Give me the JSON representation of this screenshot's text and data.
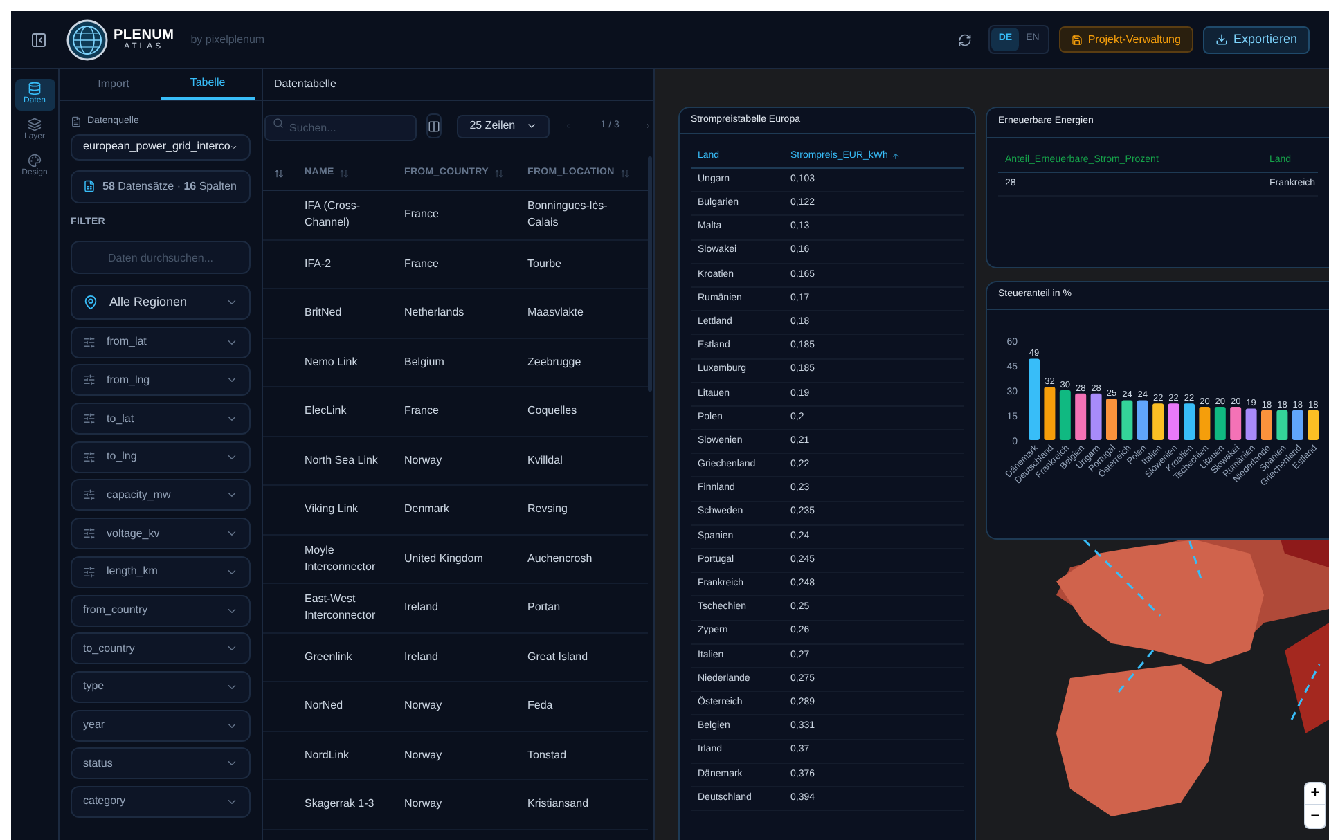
{
  "header": {
    "logo_title": "PLENUM",
    "logo_subtitle": "ATLAS",
    "byline": "by pixelplenum",
    "languages": [
      {
        "label": "DE",
        "selected": true
      },
      {
        "label": "EN",
        "selected": false
      }
    ],
    "project_button": "Projekt-Verwaltung",
    "export_button": "Exportieren"
  },
  "rail": [
    {
      "label": "Daten",
      "selected": true
    },
    {
      "label": "Layer",
      "selected": false
    },
    {
      "label": "Design",
      "selected": false
    }
  ],
  "sidebar": {
    "tabs": [
      {
        "label": "Import",
        "selected": false
      },
      {
        "label": "Tabelle",
        "selected": true
      }
    ],
    "source_label": "Datenquelle",
    "source_value": "european_power_grid_interco",
    "records": "**58** Datensätze · **16** Spalten",
    "filter_heading": "FILTER",
    "search_placeholder": "Daten durchsuchen...",
    "filters": [
      {
        "kind": "region",
        "label": "Alle Regionen"
      },
      {
        "kind": "numeric",
        "label": "from_lat"
      },
      {
        "kind": "numeric",
        "label": "from_lng"
      },
      {
        "kind": "numeric",
        "label": "to_lat"
      },
      {
        "kind": "numeric",
        "label": "to_lng"
      },
      {
        "kind": "numeric",
        "label": "capacity_mw"
      },
      {
        "kind": "numeric",
        "label": "voltage_kv"
      },
      {
        "kind": "numeric",
        "label": "length_km"
      },
      {
        "kind": "category",
        "label": "from_country"
      },
      {
        "kind": "category",
        "label": "to_country"
      },
      {
        "kind": "category",
        "label": "type"
      },
      {
        "kind": "category",
        "label": "year"
      },
      {
        "kind": "category",
        "label": "status"
      },
      {
        "kind": "category",
        "label": "category"
      }
    ]
  },
  "data_table": {
    "title": "Datentabelle",
    "search_placeholder": "Suchen...",
    "rows_per_page": "25 Zeilen",
    "page": "1 / 3",
    "columns": [
      "NAME",
      "FROM_COUNTRY",
      "FROM_LOCATION"
    ],
    "rows": [
      [
        "IFA (Cross-Channel)",
        "France",
        "Bonningues-lès-Calais"
      ],
      [
        "IFA-2",
        "France",
        "Tourbe"
      ],
      [
        "BritNed",
        "Netherlands",
        "Maasvlakte"
      ],
      [
        "Nemo Link",
        "Belgium",
        "Zeebrugge"
      ],
      [
        "ElecLink",
        "France",
        "Coquelles"
      ],
      [
        "North Sea Link",
        "Norway",
        "Kvilldal"
      ],
      [
        "Viking Link",
        "Denmark",
        "Revsing"
      ],
      [
        "Moyle Interconnector",
        "United Kingdom",
        "Auchencrosh"
      ],
      [
        "East-West Interconnector",
        "Ireland",
        "Portan"
      ],
      [
        "Greenlink",
        "Ireland",
        "Great Island"
      ],
      [
        "NorNed",
        "Norway",
        "Feda"
      ],
      [
        "NordLink",
        "Norway",
        "Tonstad"
      ],
      [
        "Skagerrak 1-3",
        "Norway",
        "Kristiansand"
      ]
    ]
  },
  "price_panel": {
    "title": "Strompreistabelle Europa",
    "columns": [
      "Land",
      "Strompreis_EUR_kWh"
    ],
    "rows": [
      [
        "Ungarn",
        "0,103"
      ],
      [
        "Bulgarien",
        "0,122"
      ],
      [
        "Malta",
        "0,13"
      ],
      [
        "Slowakei",
        "0,16"
      ],
      [
        "Kroatien",
        "0,165"
      ],
      [
        "Rumänien",
        "0,17"
      ],
      [
        "Lettland",
        "0,18"
      ],
      [
        "Estland",
        "0,185"
      ],
      [
        "Luxemburg",
        "0,185"
      ],
      [
        "Litauen",
        "0,19"
      ],
      [
        "Polen",
        "0,2"
      ],
      [
        "Slowenien",
        "0,21"
      ],
      [
        "Griechenland",
        "0,22"
      ],
      [
        "Finnland",
        "0,23"
      ],
      [
        "Schweden",
        "0,235"
      ],
      [
        "Spanien",
        "0,24"
      ],
      [
        "Portugal",
        "0,245"
      ],
      [
        "Frankreich",
        "0,248"
      ],
      [
        "Tschechien",
        "0,25"
      ],
      [
        "Zypern",
        "0,26"
      ],
      [
        "Italien",
        "0,27"
      ],
      [
        "Niederlande",
        "0,275"
      ],
      [
        "Österreich",
        "0,289"
      ],
      [
        "Belgien",
        "0,331"
      ],
      [
        "Irland",
        "0,37"
      ],
      [
        "Dänemark",
        "0,376"
      ],
      [
        "Deutschland",
        "0,394"
      ]
    ]
  },
  "renewables_panel": {
    "title": "Erneuerbare Energien",
    "columns": [
      "Anteil_Erneuerbare_Strom_Prozent",
      "Land"
    ],
    "rows": [
      [
        "28",
        "Frankreich"
      ]
    ]
  },
  "tax_panel": {
    "title": "Steueranteil in %",
    "chart_data": {
      "type": "bar",
      "categories": [
        "Dänemark",
        "Deutschland",
        "Frankreich",
        "Belgien",
        "Ungarn",
        "Portugal",
        "Österreich",
        "Polen",
        "Italien",
        "Slowenien",
        "Kroatien",
        "Tschechien",
        "Litauen",
        "Slowakei",
        "Rumänien",
        "Niederlande",
        "Spanien",
        "Griechenland",
        "Estland"
      ],
      "series": [
        {
          "colors": [
            "#38bdf8",
            "#f59e0b",
            "#10b981",
            "#f472b6",
            "#a78bfa",
            "#fb923c",
            "#34d399",
            "#60a5fa",
            "#fbbf24",
            "#e879f9",
            "#38bdf8",
            "#f59e0b",
            "#10b981",
            "#f472b6",
            "#a78bfa",
            "#fb923c",
            "#34d399",
            "#60a5fa",
            "#fbbf24"
          ],
          "values": [
            49,
            32,
            30,
            28,
            28,
            25,
            24,
            24,
            22,
            22,
            22,
            20,
            20,
            20,
            19,
            18,
            18,
            18,
            18
          ]
        }
      ],
      "ylim": [
        0,
        60
      ],
      "yticks": [
        0,
        15,
        30,
        45,
        60
      ],
      "data_labels": true
    }
  },
  "map": {
    "zoom_in": "+",
    "zoom_out": "−"
  }
}
